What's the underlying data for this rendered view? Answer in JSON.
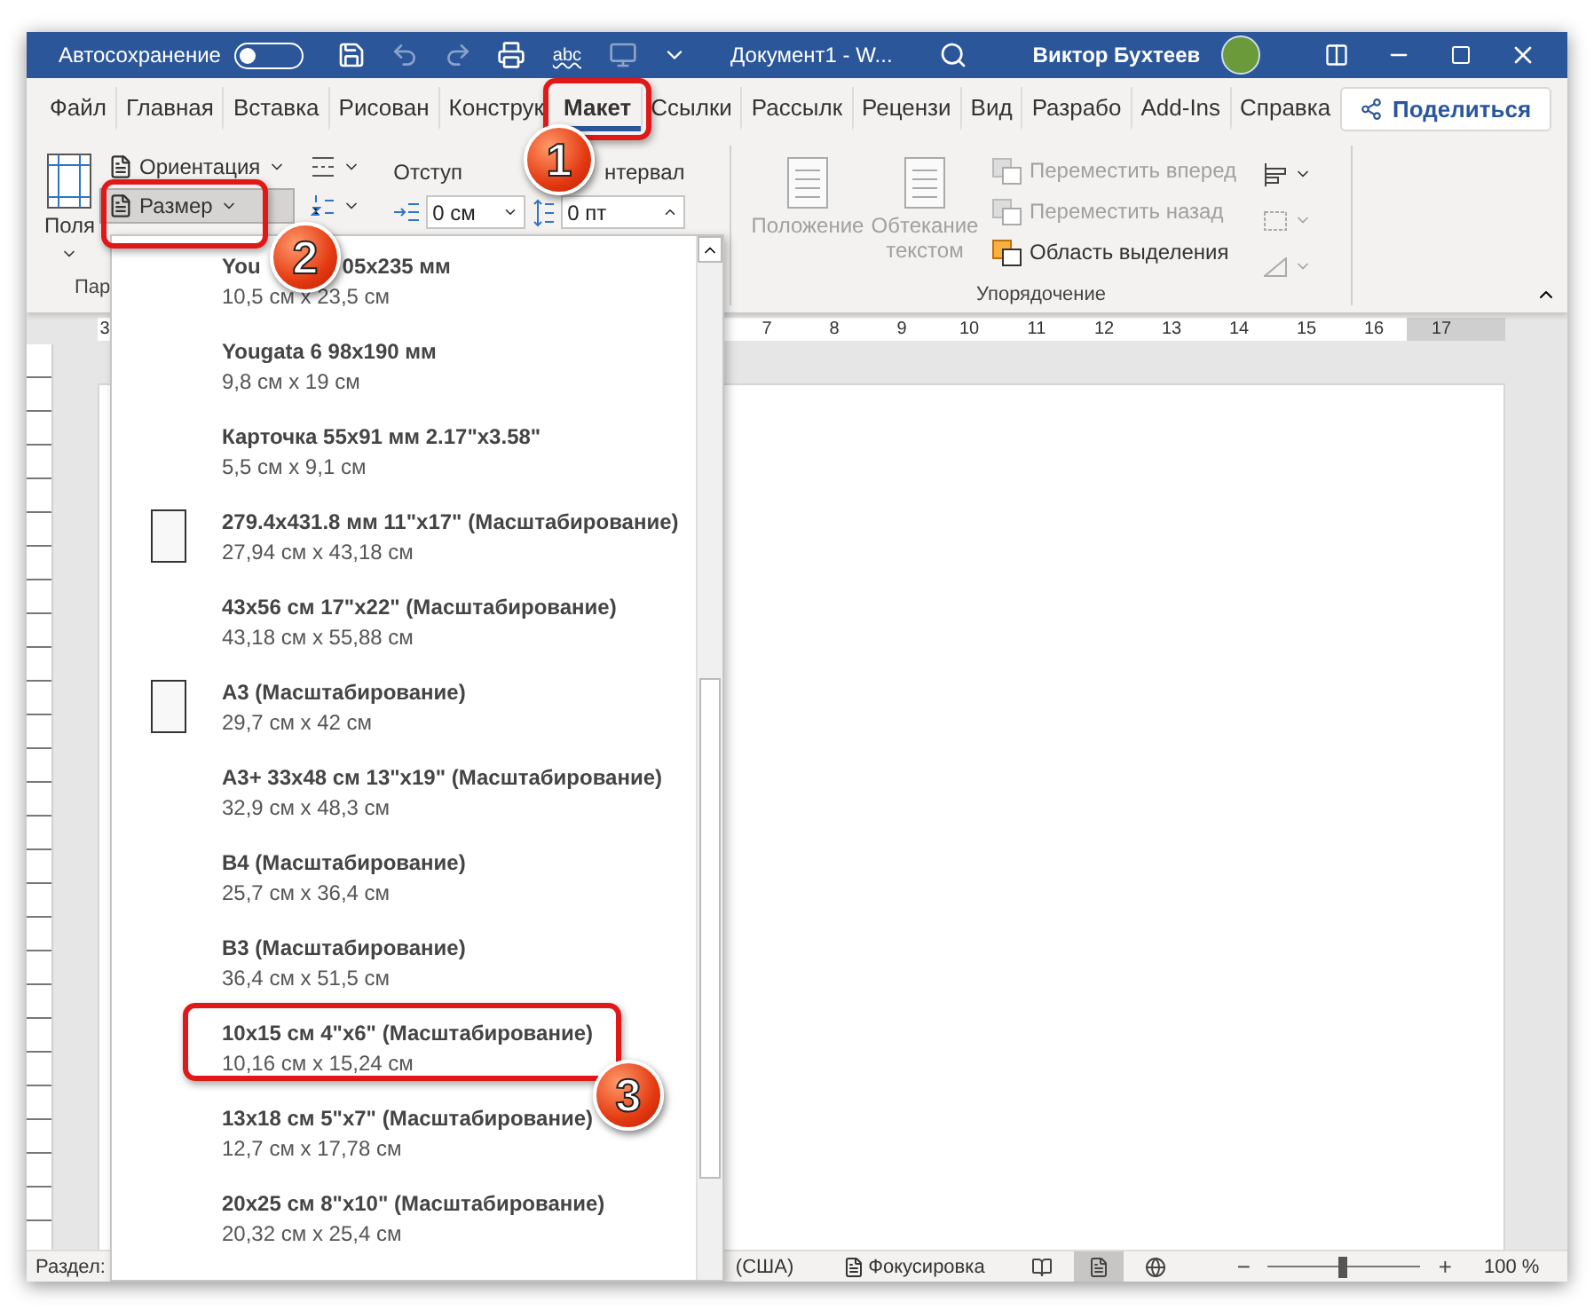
{
  "title_bar": {
    "autosave_label": "Автосохранение",
    "autosave_on": false,
    "spelling_label": "abc",
    "document_title": "Документ1  -  W...",
    "user_name": "Виктор Бухтеев"
  },
  "tabs": [
    {
      "label": "Файл",
      "selected": false
    },
    {
      "label": "Главная",
      "selected": false
    },
    {
      "label": "Вставка",
      "selected": false
    },
    {
      "label": "Рисован",
      "selected": false
    },
    {
      "label": "Конструк",
      "selected": false
    },
    {
      "label": "Макет",
      "selected": true
    },
    {
      "label": "Ссылки",
      "selected": false
    },
    {
      "label": "Рассылк",
      "selected": false
    },
    {
      "label": "Рецензи",
      "selected": false
    },
    {
      "label": "Вид",
      "selected": false
    },
    {
      "label": "Разрабо",
      "selected": false
    },
    {
      "label": "Add-Ins",
      "selected": false
    },
    {
      "label": "Справка",
      "selected": false
    }
  ],
  "share_button": "Поделиться",
  "ribbon": {
    "margins_label": "Поля",
    "orientation_label": "Ориентация",
    "size_label": "Размер",
    "size_pressed": true,
    "indent_label": "Отступ",
    "spacing_label": "нтервал",
    "indent_value": "0 см",
    "spacing_value": "0 пт",
    "page_setup_group": "Пар",
    "large_buttons": [
      {
        "label": "Положение",
        "disabled": true
      },
      {
        "label": "Обтекание текстом",
        "disabled": true
      }
    ],
    "arrange_buttons": [
      {
        "label": "Переместить вперед",
        "disabled": true
      },
      {
        "label": "Переместить назад",
        "disabled": true
      },
      {
        "label": "Область выделения",
        "disabled": false
      }
    ],
    "arrange_group": "Упорядочение"
  },
  "ruler": {
    "numbers": [
      "3",
      "7",
      "8",
      "9",
      "10",
      "11",
      "12",
      "13",
      "14",
      "15",
      "16",
      "17"
    ]
  },
  "size_menu": {
    "items": [
      {
        "name": "You",
        "name_rest": "05x235 мм",
        "size": "10,5 см x 23,5 см",
        "thumbnail": false
      },
      {
        "name": "Yougata 6 98x190 мм",
        "size": "9,8 см x 19 см",
        "thumbnail": false
      },
      {
        "name": "Карточка 55x91 мм 2.17\"x3.58\"",
        "size": "5,5 см x 9,1 см",
        "thumbnail": false
      },
      {
        "name": "279.4x431.8 мм 11\"x17\" (Масштабирование)",
        "size": "27,94 см x 43,18 см",
        "thumbnail": true
      },
      {
        "name": "43x56 см 17\"x22\" (Масштабирование)",
        "size": "43,18 см x 55,88 см",
        "thumbnail": false
      },
      {
        "name": "A3 (Масштабирование)",
        "size": "29,7 см x 42 см",
        "thumbnail": true
      },
      {
        "name": "A3+ 33x48 см 13\"x19\" (Масштабирование)",
        "size": "32,9 см x 48,3 см",
        "thumbnail": false
      },
      {
        "name": "B4 (Масштабирование)",
        "size": "25,7 см x 36,4 см",
        "thumbnail": false
      },
      {
        "name": "B3 (Масштабирование)",
        "size": "36,4 см x 51,5 см",
        "thumbnail": false
      },
      {
        "name": "10x15 см 4\"x6\" (Масштабирование)",
        "size": "10,16 см x 15,24 см",
        "thumbnail": false
      },
      {
        "name": "13x18 см 5\"x7\" (Масштабирование)",
        "size": "12,7 см x 17,78 см",
        "thumbnail": false
      },
      {
        "name": "20x25 см 8\"x10\" (Масштабирование)",
        "size": "20,32 см x 25,4 см",
        "thumbnail": false
      }
    ]
  },
  "status_bar": {
    "section": "Раздел:",
    "language": "(США)",
    "focus": "Фокусировка",
    "views": [
      {
        "selected": false
      },
      {
        "selected": true
      },
      {
        "selected": false
      }
    ],
    "zoom_minus": "−",
    "zoom_plus": "+",
    "zoom": {
      "level": 0.48
    },
    "zoom_reading": "100 %"
  },
  "callouts": [
    {
      "number": "1"
    },
    {
      "number": "2"
    },
    {
      "number": "3"
    }
  ]
}
